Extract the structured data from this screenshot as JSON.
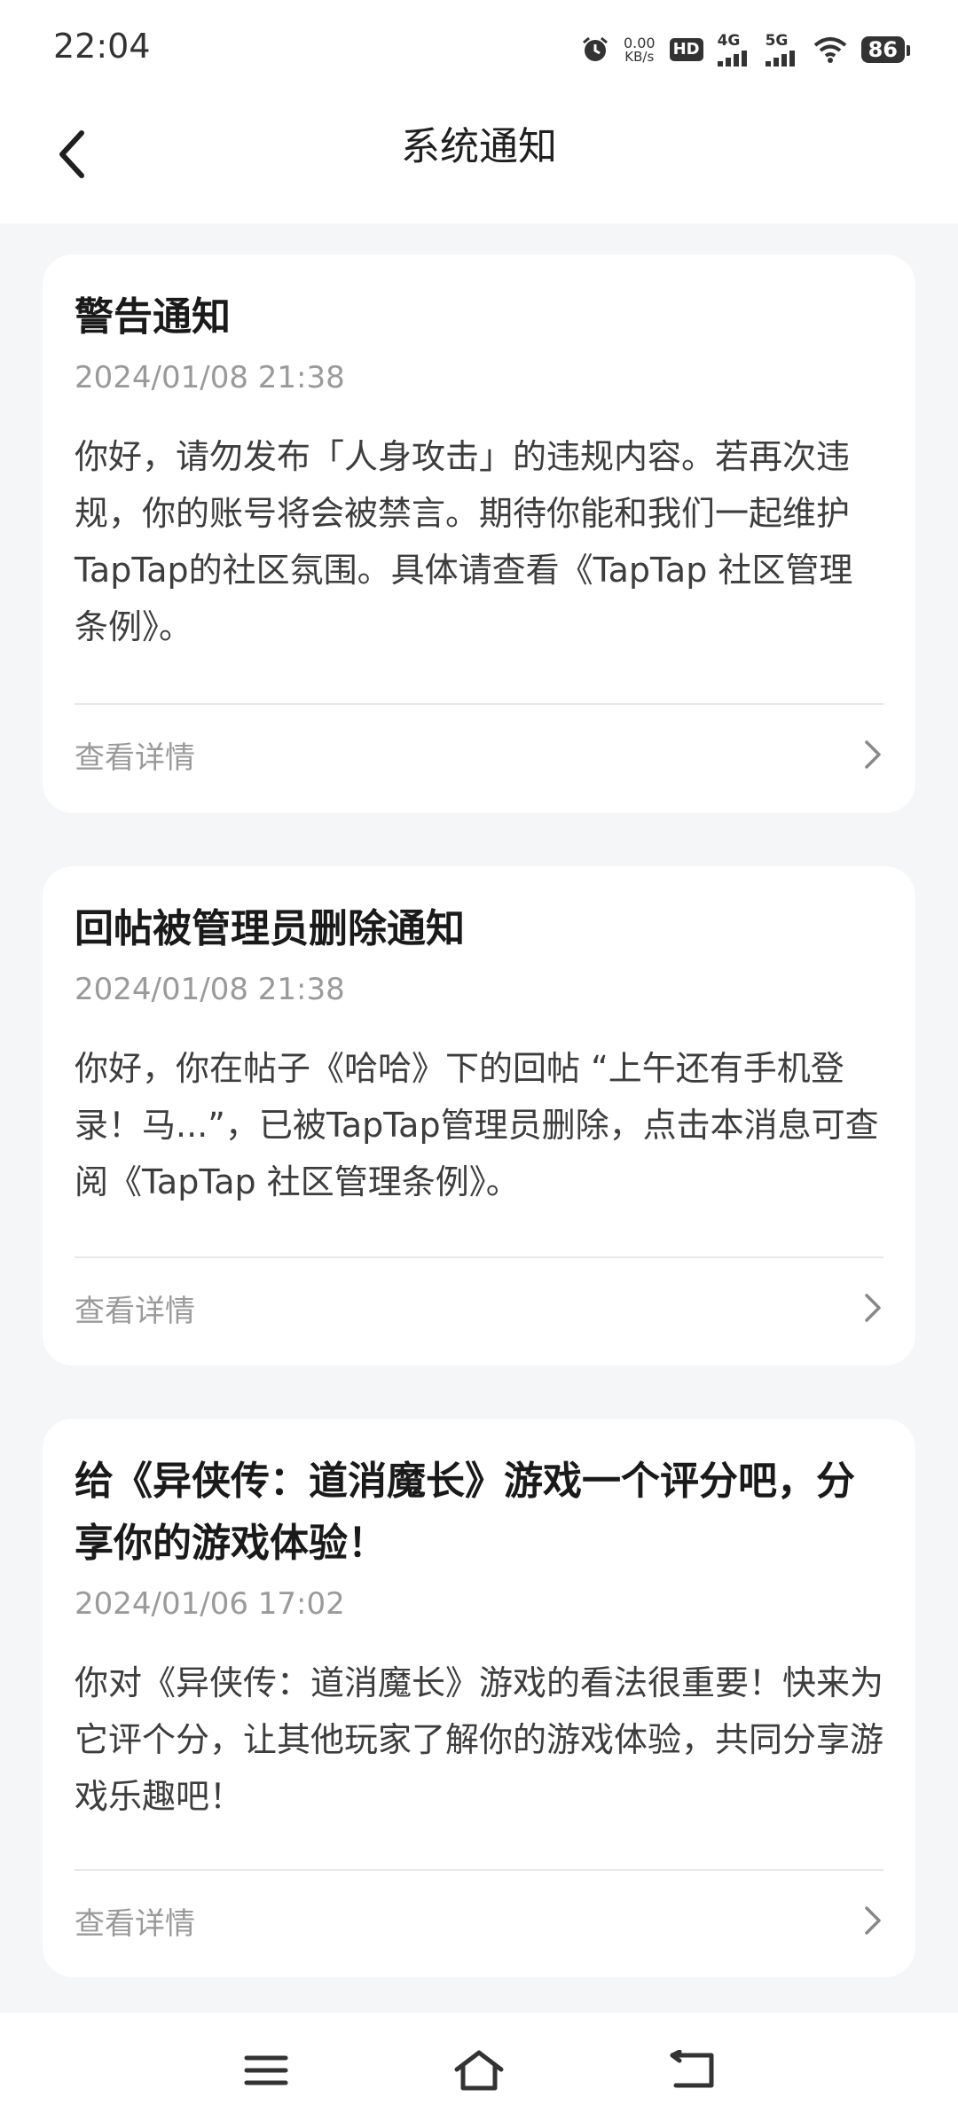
{
  "status_bar": {
    "time": "22:04",
    "net_speed_value": "0.00",
    "net_speed_unit": "KB/s",
    "hd_label": "HD",
    "sim1_label": "4G",
    "sim2_label": "5G",
    "battery": "86",
    "icons": [
      "alarm-icon",
      "hd-icon",
      "signal-icon",
      "wifi-icon",
      "battery-icon"
    ]
  },
  "header": {
    "title": "系统通知",
    "back_icon": "chevron-left-icon"
  },
  "notifications": [
    {
      "title": "警告通知",
      "time": "2024/01/08 21:38",
      "body": "你好，请勿发布「人身攻击」的违规内容。若再次违规，你的账号将会被禁言。期待你能和我们一起维护TapTap的社区氛围。具体请查看《TapTap 社区管理条例》。",
      "action": "查看详情"
    },
    {
      "title": "回帖被管理员删除通知",
      "time": "2024/01/08 21:38",
      "body": "你好，你在帖子《哈哈》下的回帖 “上午还有手机登录！马...”，已被TapTap管理员删除，点击本消息可查阅《TapTap 社区管理条例》。",
      "action": "查看详情"
    },
    {
      "title": "给《异侠传：道消魔长》游戏一个评分吧，分享你的游戏体验！",
      "time": "2024/01/06 17:02",
      "body": "你对《异侠传：道消魔长》游戏的看法很重要！快来为它评个分，让其他玩家了解你的游戏体验，共同分享游戏乐趣吧！",
      "action": "查看详情"
    }
  ],
  "nav_bar": {
    "icons": [
      "menu-icon",
      "home-icon",
      "back-icon"
    ]
  }
}
